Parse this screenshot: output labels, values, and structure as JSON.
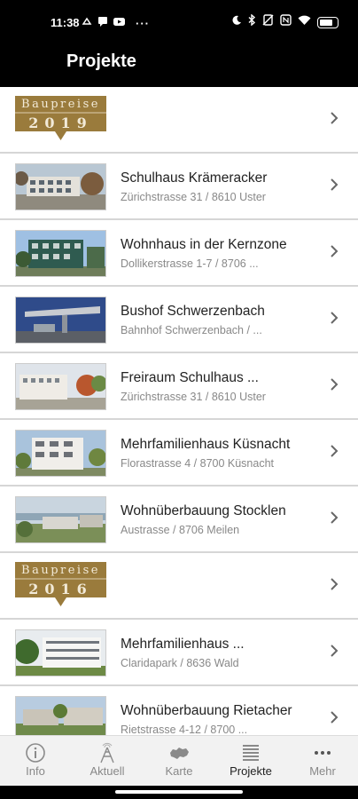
{
  "status_bar": {
    "time": "11:38",
    "icons_left": [
      "cloud-sync-icon",
      "message-icon",
      "youtube-icon"
    ],
    "more": "···",
    "icons_right": [
      "moon-icon",
      "bluetooth-icon",
      "no-sim-icon",
      "nfc-icon",
      "wifi-icon",
      "battery-icon"
    ],
    "battery": "61"
  },
  "header": {
    "title": "Projekte"
  },
  "accent_color": "#9a7b3c",
  "list": [
    {
      "type": "section",
      "word": "Baupreise",
      "year": "2019"
    },
    {
      "type": "project",
      "title": "Schulhaus Krämeracker",
      "subtitle": "Zürichstrasse 31  /  8610 Uster",
      "thumb": "school-building-photo"
    },
    {
      "type": "project",
      "title": "Wohnhaus in der Kernzone",
      "subtitle": "Dollikerstrasse 1-7 / 8706 ...",
      "thumb": "green-residential-building-photo"
    },
    {
      "type": "project",
      "title": "Bushof Schwerzenbach",
      "subtitle": "Bahnhof Schwerzenbach  /  ...",
      "thumb": "bus-shelter-photo"
    },
    {
      "type": "project",
      "title": "Freiraum Schulhaus ...",
      "subtitle": "Zürichstrasse 31  /  8610 Uster",
      "thumb": "schoolyard-photo"
    },
    {
      "type": "project",
      "title": "Mehrfamilienhaus Küsnacht",
      "subtitle": "Florastrasse 4  /  8700 Küsnacht",
      "thumb": "white-apartment-building-photo"
    },
    {
      "type": "project",
      "title": "Wohnüberbauung Stocklen",
      "subtitle": "Austrasse  /  8706 Meilen",
      "thumb": "hillside-housing-photo"
    },
    {
      "type": "section",
      "word": "Baupreise",
      "year": "2016"
    },
    {
      "type": "project",
      "title": "Mehrfamilienhaus ...",
      "subtitle": "Claridapark / 8636 Wald",
      "thumb": "apartment-trees-photo"
    },
    {
      "type": "project",
      "title": "Wohnüberbauung Rietacher",
      "subtitle": "Rietstrasse 4-12  /  8700 ...",
      "thumb": "housing-rietacher-photo"
    }
  ],
  "tabs": [
    {
      "label": "Info",
      "icon": "info-icon",
      "active": false
    },
    {
      "label": "Aktuell",
      "icon": "antenna-icon",
      "active": false
    },
    {
      "label": "Karte",
      "icon": "switzerland-map-icon",
      "active": false
    },
    {
      "label": "Projekte",
      "icon": "list-icon",
      "active": true
    },
    {
      "label": "Mehr",
      "icon": "more-icon",
      "active": false
    }
  ]
}
